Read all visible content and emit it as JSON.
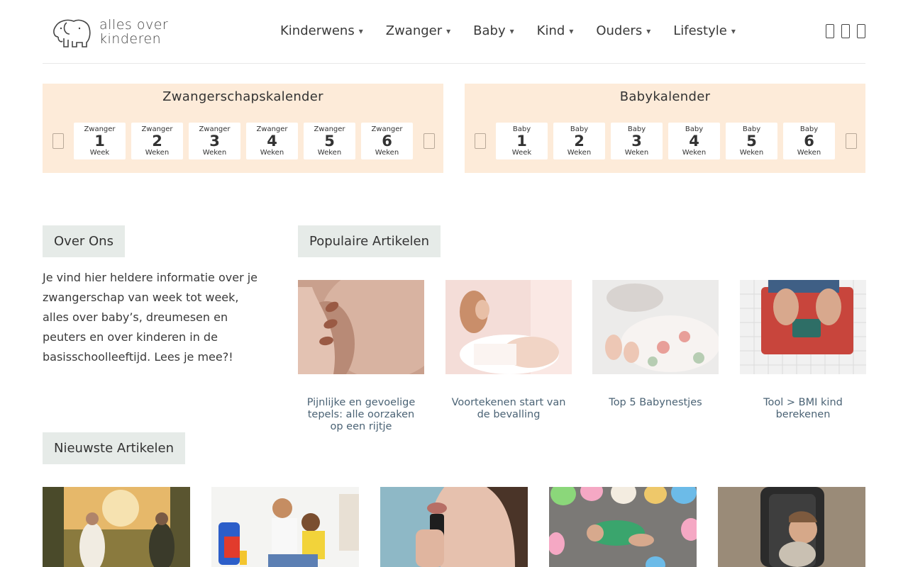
{
  "logo": {
    "line1": "alles over",
    "line2": "kinderen"
  },
  "nav": [
    {
      "label": "Kinderwens"
    },
    {
      "label": "Zwanger"
    },
    {
      "label": "Baby"
    },
    {
      "label": "Kind"
    },
    {
      "label": "Ouders"
    },
    {
      "label": "Lifestyle"
    }
  ],
  "calendars": [
    {
      "title": "Zwangerschapskalender",
      "cards": [
        {
          "top": "Zwanger",
          "num": "1",
          "bot": "Week"
        },
        {
          "top": "Zwanger",
          "num": "2",
          "bot": "Weken"
        },
        {
          "top": "Zwanger",
          "num": "3",
          "bot": "Weken"
        },
        {
          "top": "Zwanger",
          "num": "4",
          "bot": "Weken"
        },
        {
          "top": "Zwanger",
          "num": "5",
          "bot": "Weken"
        },
        {
          "top": "Zwanger",
          "num": "6",
          "bot": "Weken"
        }
      ]
    },
    {
      "title": "Babykalender",
      "cards": [
        {
          "top": "Baby",
          "num": "1",
          "bot": "Week"
        },
        {
          "top": "Baby",
          "num": "2",
          "bot": "Weken"
        },
        {
          "top": "Baby",
          "num": "3",
          "bot": "Weken"
        },
        {
          "top": "Baby",
          "num": "4",
          "bot": "Weken"
        },
        {
          "top": "Baby",
          "num": "5",
          "bot": "Weken"
        },
        {
          "top": "Baby",
          "num": "6",
          "bot": "Weken"
        }
      ]
    }
  ],
  "about": {
    "heading": "Over Ons",
    "text": "Je vind hier heldere informatie over je zwangerschap van week tot week, alles over baby’s, dreumesen en peuters en over kinderen in de basisschoolleeftijd. Lees je mee?!"
  },
  "popular": {
    "heading": "Populaire Artikelen",
    "articles": [
      {
        "title": "Pijnlijke en gevoelige tepels: alle oorzaken op een rijtje"
      },
      {
        "title": "Voortekenen start van de bevalling"
      },
      {
        "title": "Top 5 Babynestjes"
      },
      {
        "title": "Tool > BMI kind berekenen"
      }
    ]
  },
  "newest": {
    "heading": "Nieuwste Artikelen"
  },
  "colors": {
    "calendar_bg": "#fdebd9",
    "heading_bg": "#e6ebe8",
    "link": "#4b6375"
  }
}
